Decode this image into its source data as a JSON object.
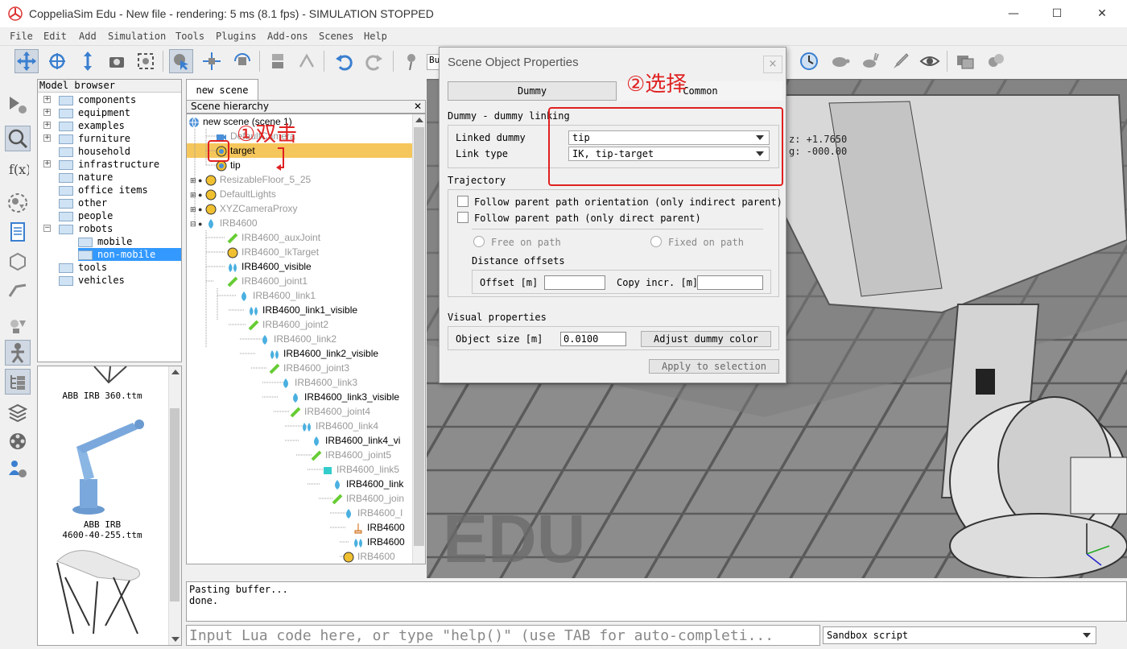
{
  "window": {
    "title": "CoppeliaSim Edu - New file - rendering: 5 ms (8.1 fps) - SIMULATION STOPPED",
    "minimize": "—",
    "maximize": "☐",
    "close": "✕"
  },
  "menu": [
    "File",
    "Edit",
    "Add",
    "Simulation",
    "Tools",
    "Plugins",
    "Add-ons",
    "Scenes",
    "Help"
  ],
  "model_browser": {
    "header": "Model browser",
    "items": [
      "components",
      "equipment",
      "examples",
      "furniture",
      "household",
      "infrastructure",
      "nature",
      "office items",
      "other",
      "people",
      "robots",
      "mobile",
      "non-mobile",
      "tools",
      "vehicles"
    ]
  },
  "thumbs": {
    "t1": "ABB IRB 360.ttm",
    "t2a": "ABB IRB",
    "t2b": "4600-40-255.ttm"
  },
  "scene_tab": "new scene",
  "hierarchy": {
    "header": "Scene hierarchy",
    "close": "✕",
    "items": [
      "new scene (scene 1)",
      "DefaultCamera",
      "target",
      "tip",
      "ResizableFloor_5_25",
      "DefaultLights",
      "XYZCameraProxy",
      "IRB4600",
      "IRB4600_auxJoint",
      "IRB4600_IkTarget",
      "IRB4600_visible",
      "IRB4600_joint1",
      "IRB4600_link1",
      "IRB4600_link1_visible",
      "IRB4600_joint2",
      "IRB4600_link2",
      "IRB4600_link2_visible",
      "IRB4600_joint3",
      "IRB4600_link3",
      "IRB4600_link3_visible",
      "IRB4600_joint4",
      "IRB4600_link4",
      "IRB4600_link4_vi",
      "IRB4600_joint5",
      "IRB4600_link5",
      "IRB4600_link",
      "IRB4600_join",
      "IRB4600_l",
      "IRB4600",
      "IRB4600",
      "IRB4600"
    ]
  },
  "viewport": {
    "watermark": "EDU",
    "readout_z": "z: +1.7650",
    "readout_g": "g: -000.00"
  },
  "console": {
    "line1": "Pasting buffer...",
    "line2": "done.",
    "placeholder": "Input Lua code here, or type \"help()\" (use TAB for auto-completi...",
    "sandbox": "Sandbox script"
  },
  "dialog": {
    "title": "Scene Object Properties",
    "close": "×",
    "tab_dummy": "Dummy",
    "tab_common": "Common",
    "section_linking": "Dummy - dummy linking",
    "linked_dummy_label": "Linked dummy",
    "linked_dummy_value": "tip",
    "link_type_label": "Link type",
    "link_type_value": "IK, tip-target",
    "section_trajectory": "Trajectory",
    "follow_orientation": "Follow parent path orientation (only indirect parent)",
    "follow_path": "Follow parent path (only direct parent)",
    "free_on_path": "Free on path",
    "fixed_on_path": "Fixed on path",
    "distance_offsets": "Distance offsets",
    "offset_label": "Offset [m]",
    "offset_value": "",
    "copy_incr_label": "Copy incr. [m]",
    "copy_incr_value": "",
    "section_visual": "Visual properties",
    "object_size_label": "Object size [m]",
    "object_size_value": "0.0100",
    "adjust_color": "Adjust dummy color",
    "apply_selection": "Apply to selection"
  },
  "annotations": {
    "step1": "①双击",
    "step2": "②选择"
  },
  "colors": {
    "selection": "#f5c65c",
    "annotation": "#e02020",
    "accent": "#4a8fd8"
  }
}
